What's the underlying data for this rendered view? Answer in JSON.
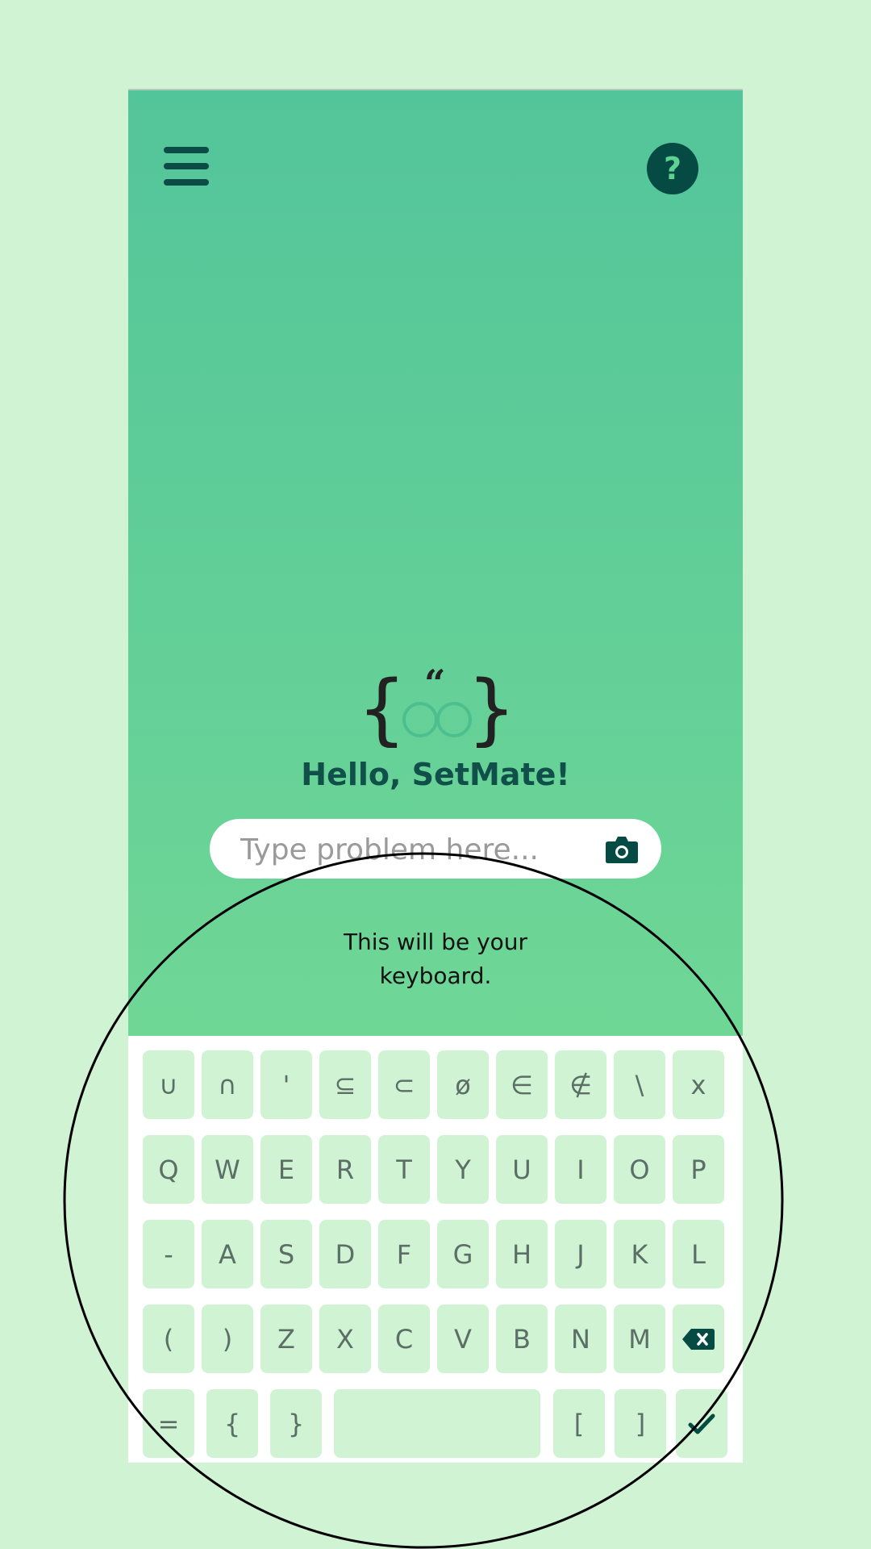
{
  "header": {
    "menu_icon": "hamburger-menu-icon",
    "help_label": "?"
  },
  "mascot": {
    "icon": "setmate-logo"
  },
  "greeting": "Hello, SetMate!",
  "search": {
    "placeholder": "Type problem here...",
    "value": "",
    "camera_icon": "camera-icon"
  },
  "keyboard_note": {
    "line1": "This will be your",
    "line2": "keyboard."
  },
  "keyboard": {
    "rows": [
      [
        "∪",
        "∩",
        "'",
        "⊆",
        "⊂",
        "ø",
        "∈",
        "∉",
        "\\",
        "x"
      ],
      [
        "Q",
        "W",
        "E",
        "R",
        "T",
        "Y",
        "U",
        "I",
        "O",
        "P"
      ],
      [
        "-",
        "A",
        "S",
        "D",
        "F",
        "G",
        "H",
        "J",
        "K",
        "L"
      ],
      [
        "(",
        ")",
        "Z",
        "X",
        "C",
        "V",
        "B",
        "N",
        "M",
        "backspace-icon"
      ],
      [
        "=",
        "{",
        "}",
        "space",
        "[",
        "]",
        "check-icon"
      ]
    ]
  },
  "colors": {
    "page_background": "#cff3d3",
    "app_gradient_top": "#53c59a",
    "app_gradient_bottom": "#6fd796",
    "key_background": "#cff3d3",
    "dark_accent": "#064a44"
  }
}
